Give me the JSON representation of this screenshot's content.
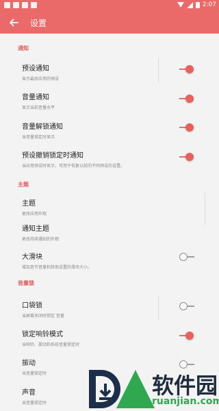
{
  "statusbar": {
    "time": "2:07"
  },
  "appbar": {
    "title": "设置"
  },
  "sections": {
    "notify": "通知",
    "theme": "主题",
    "volume_lock": "音量锁"
  },
  "items": {
    "preset_notify": {
      "title": "预设通知",
      "subtitle": "显示最后应用的预设",
      "on": true
    },
    "volume_notify": {
      "title": "音量通知",
      "subtitle": "显示当前音量水平",
      "on": true
    },
    "unlock_notify": {
      "title": "音量解锁通知",
      "subtitle": "当音量锁定时显示",
      "on": true
    },
    "preset_lock_notify": {
      "title": "预设撤销锁定时通知",
      "subtitle": "当应用预设时显示，可用于恢复以前的不同预设的设置。",
      "on": true
    },
    "theme": {
      "title": "主题",
      "subtitle": "更改应用外观"
    },
    "notify_theme": {
      "title": "通知主题",
      "subtitle": "更改持续通知的外观"
    },
    "big_slider": {
      "title": "大滑块",
      "subtitle": "增加音节音量和其他设置的滑块大小。",
      "on": false
    },
    "pocket_lock": {
      "title": "口袋锁",
      "subtitle": "当屏幕关闭时锁定 音量",
      "on": false
    },
    "ringer_lock": {
      "title": "锁定响铃模式",
      "subtitle": "当响铃、震动和系统音量锁定时",
      "on": true
    },
    "vibrate": {
      "title": "振动",
      "subtitle": "当音量锁定时",
      "on": false
    },
    "sound": {
      "title": "声音",
      "subtitle": "当音量锁定时"
    }
  },
  "watermark": {
    "text": "软件园",
    "url": "ruanjian.com"
  },
  "colors": {
    "accent": "#ea6a6a",
    "toggle_on": "#e8615f"
  }
}
